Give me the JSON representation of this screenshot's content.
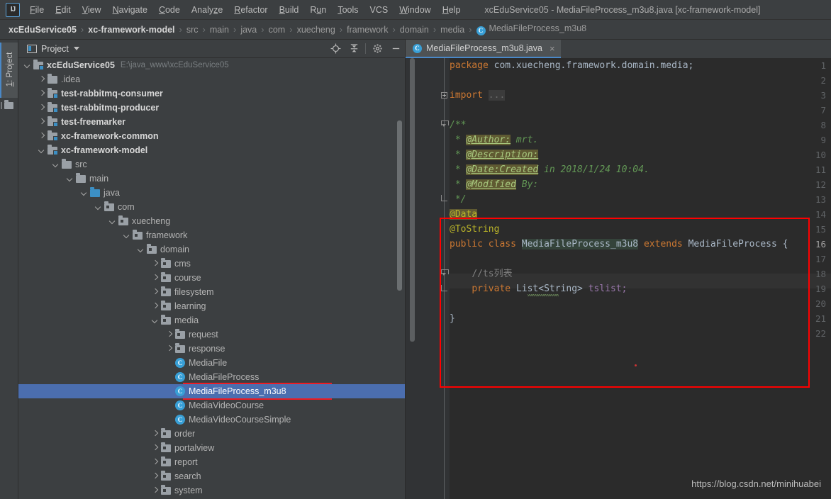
{
  "window": {
    "title": "xcEduService05 - MediaFileProcess_m3u8.java [xc-framework-model]"
  },
  "menubar": {
    "logo": "IJ",
    "items": [
      {
        "label": "File"
      },
      {
        "label": "Edit"
      },
      {
        "label": "View"
      },
      {
        "label": "Navigate"
      },
      {
        "label": "Code"
      },
      {
        "label": "Analyze"
      },
      {
        "label": "Refactor"
      },
      {
        "label": "Build"
      },
      {
        "label": "Run"
      },
      {
        "label": "Tools"
      },
      {
        "label": "VCS"
      },
      {
        "label": "Window"
      },
      {
        "label": "Help"
      }
    ]
  },
  "breadcrumb": {
    "items": [
      {
        "label": "xcEduService05",
        "bold": true
      },
      {
        "label": "xc-framework-model",
        "bold": true
      },
      {
        "label": "src",
        "bold": false
      },
      {
        "label": "main",
        "bold": false
      },
      {
        "label": "java",
        "bold": false
      },
      {
        "label": "com",
        "bold": false
      },
      {
        "label": "xuecheng",
        "bold": false
      },
      {
        "label": "framework",
        "bold": false
      },
      {
        "label": "domain",
        "bold": false
      },
      {
        "label": "media",
        "bold": false
      }
    ],
    "final": "MediaFileProcess_m3u8",
    "final_icon": "C"
  },
  "leftbar": {
    "tab_label": "1: Project"
  },
  "project_panel": {
    "title": "Project",
    "tools": [
      {
        "name": "locate-icon"
      },
      {
        "name": "collapse-all-icon"
      },
      {
        "name": "settings-gear-icon"
      },
      {
        "name": "hide-panel-icon"
      }
    ],
    "tree": [
      {
        "depth": 0,
        "arrow": "down",
        "icon": "module",
        "label": "xcEduService05",
        "bold": true,
        "hint": "E:\\java_www\\xcEduService05"
      },
      {
        "depth": 1,
        "arrow": "right",
        "icon": "folder",
        "label": ".idea",
        "bold": false,
        "hint": ""
      },
      {
        "depth": 1,
        "arrow": "right",
        "icon": "module",
        "label": "test-rabbitmq-consumer",
        "bold": true,
        "hint": ""
      },
      {
        "depth": 1,
        "arrow": "right",
        "icon": "module",
        "label": "test-rabbitmq-producer",
        "bold": true,
        "hint": ""
      },
      {
        "depth": 1,
        "arrow": "right",
        "icon": "module",
        "label": "test-freemarker",
        "bold": true,
        "hint": ""
      },
      {
        "depth": 1,
        "arrow": "right",
        "icon": "module",
        "label": "xc-framework-common",
        "bold": true,
        "hint": ""
      },
      {
        "depth": 1,
        "arrow": "down",
        "icon": "module",
        "label": "xc-framework-model",
        "bold": true,
        "hint": ""
      },
      {
        "depth": 2,
        "arrow": "down",
        "icon": "folder",
        "label": "src",
        "bold": false,
        "hint": ""
      },
      {
        "depth": 3,
        "arrow": "down",
        "icon": "folder",
        "label": "main",
        "bold": false,
        "hint": ""
      },
      {
        "depth": 4,
        "arrow": "down",
        "icon": "srcfolder",
        "label": "java",
        "bold": false,
        "hint": ""
      },
      {
        "depth": 5,
        "arrow": "down",
        "icon": "package",
        "label": "com",
        "bold": false,
        "hint": ""
      },
      {
        "depth": 6,
        "arrow": "down",
        "icon": "package",
        "label": "xuecheng",
        "bold": false,
        "hint": ""
      },
      {
        "depth": 7,
        "arrow": "down",
        "icon": "package",
        "label": "framework",
        "bold": false,
        "hint": ""
      },
      {
        "depth": 8,
        "arrow": "down",
        "icon": "package",
        "label": "domain",
        "bold": false,
        "hint": ""
      },
      {
        "depth": 9,
        "arrow": "right",
        "icon": "package",
        "label": "cms",
        "bold": false,
        "hint": ""
      },
      {
        "depth": 9,
        "arrow": "right",
        "icon": "package",
        "label": "course",
        "bold": false,
        "hint": ""
      },
      {
        "depth": 9,
        "arrow": "right",
        "icon": "package",
        "label": "filesystem",
        "bold": false,
        "hint": ""
      },
      {
        "depth": 9,
        "arrow": "right",
        "icon": "package",
        "label": "learning",
        "bold": false,
        "hint": ""
      },
      {
        "depth": 9,
        "arrow": "down",
        "icon": "package",
        "label": "media",
        "bold": false,
        "hint": ""
      },
      {
        "depth": 10,
        "arrow": "right",
        "icon": "package",
        "label": "request",
        "bold": false,
        "hint": ""
      },
      {
        "depth": 10,
        "arrow": "right",
        "icon": "package",
        "label": "response",
        "bold": false,
        "hint": ""
      },
      {
        "depth": 10,
        "arrow": "none",
        "icon": "class",
        "label": "MediaFile",
        "bold": false,
        "hint": ""
      },
      {
        "depth": 10,
        "arrow": "none",
        "icon": "class",
        "label": "MediaFileProcess",
        "bold": false,
        "hint": ""
      },
      {
        "depth": 10,
        "arrow": "none",
        "icon": "class",
        "label": "MediaFileProcess_m3u8",
        "bold": false,
        "hint": "",
        "selected": true
      },
      {
        "depth": 10,
        "arrow": "none",
        "icon": "class",
        "label": "MediaVideoCourse",
        "bold": false,
        "hint": ""
      },
      {
        "depth": 10,
        "arrow": "none",
        "icon": "class",
        "label": "MediaVideoCourseSimple",
        "bold": false,
        "hint": ""
      },
      {
        "depth": 9,
        "arrow": "right",
        "icon": "package",
        "label": "order",
        "bold": false,
        "hint": ""
      },
      {
        "depth": 9,
        "arrow": "right",
        "icon": "package",
        "label": "portalview",
        "bold": false,
        "hint": ""
      },
      {
        "depth": 9,
        "arrow": "right",
        "icon": "package",
        "label": "report",
        "bold": false,
        "hint": ""
      },
      {
        "depth": 9,
        "arrow": "right",
        "icon": "package",
        "label": "search",
        "bold": false,
        "hint": ""
      },
      {
        "depth": 9,
        "arrow": "right",
        "icon": "package",
        "label": "system",
        "bold": false,
        "hint": ""
      }
    ]
  },
  "editor": {
    "tab": {
      "label": "MediaFileProcess_m3u8.java",
      "icon": "C",
      "close": "×"
    },
    "line_numbers": [
      "1",
      "2",
      "3",
      "7",
      "8",
      "9",
      "10",
      "11",
      "12",
      "13",
      "14",
      "15",
      "16",
      "17",
      "18",
      "19",
      "20",
      "21",
      "22"
    ],
    "current_line": "16",
    "lines": [
      "package com.xuecheng.framework.domain.media;",
      "",
      "import ...",
      "",
      "/**",
      " * @Author: mrt.",
      " * @Description:",
      " * @Date:Created in 2018/1/24 10:04.",
      " * @Modified By:",
      " */",
      "@Data",
      "@ToString",
      "public class MediaFileProcess_m3u8 extends MediaFileProcess {",
      "",
      "    //ts列表",
      "    private List<String> tslist;",
      "",
      "}",
      ""
    ],
    "tokens": {
      "kw_package": "package",
      "package_name": "com.xuecheng.framework.domain.media;",
      "kw_import": "import",
      "import_fold": "...",
      "jdoc_open": "/**",
      "jdoc_star": " * ",
      "tag_author": "@Author:",
      "author_value": " mrt.",
      "tag_description": "@Description:",
      "tag_date": "@Date:Created",
      "date_value": " in 2018/1/24 10:04.",
      "tag_modified": "@Modified",
      "modified_value": " By:",
      "jdoc_close": " */",
      "ann_data": "@Data",
      "ann_tostring": "@ToString",
      "kw_public": "public",
      "kw_class": "class",
      "class_name": "MediaFileProcess_m3u8",
      "kw_extends": "extends",
      "super_name": "MediaFileProcess",
      "brace_open": "{",
      "comment_ts": "//ts列表",
      "kw_private": "private",
      "type_list": "List<String>",
      "field_tslist": "tslist;",
      "brace_close": "}"
    }
  },
  "watermark": {
    "text": "https://blog.csdn.net/minihuabei"
  },
  "colors": {
    "accent": "#4a88c7",
    "selection": "#4b6eaf",
    "annotation_red": "#ff0000",
    "keyword": "#cc7832",
    "identifier": "#a9b7c6",
    "javadoc": "#629755",
    "annotation_yellow": "#bbb529",
    "field": "#9876aa",
    "comment": "#808080",
    "editor_bg": "#2b2b2b",
    "panel_bg": "#3c3f41",
    "class_icon": "#389fd6"
  }
}
